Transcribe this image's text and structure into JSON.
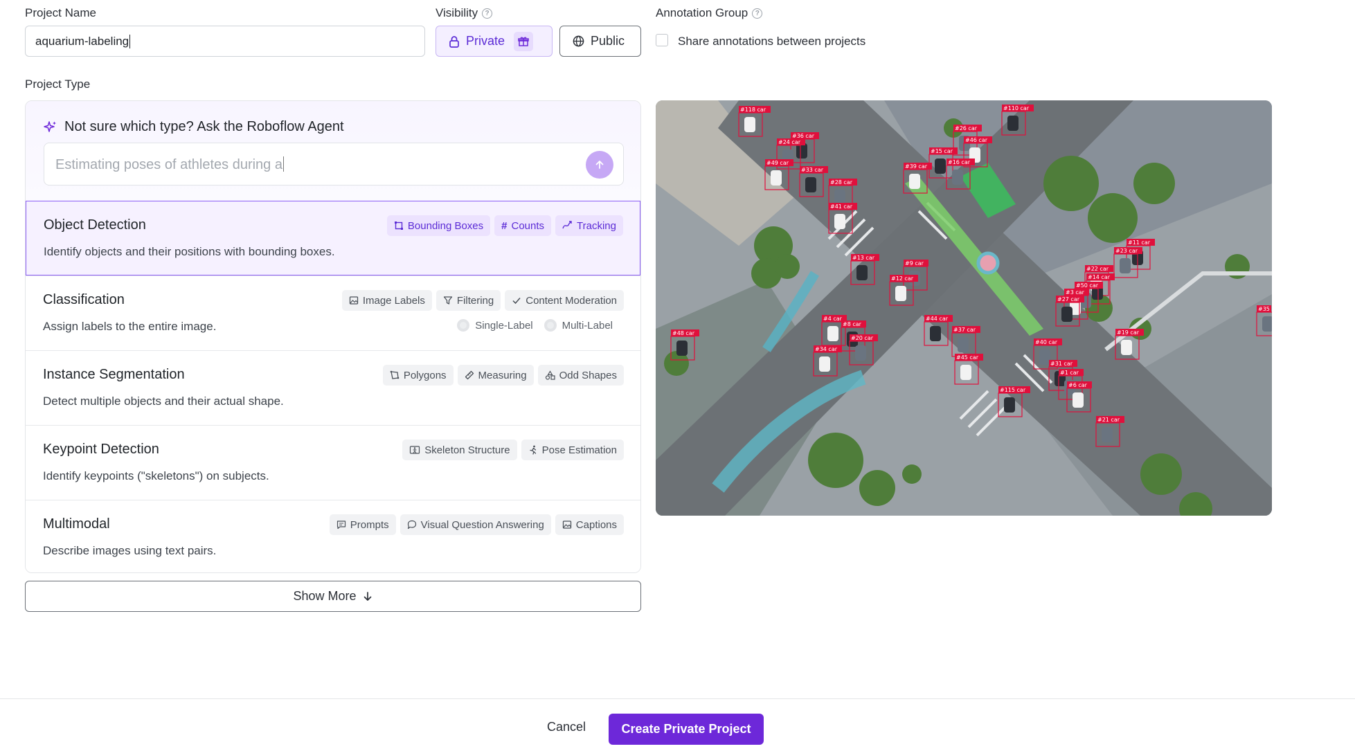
{
  "project_name": {
    "label": "Project Name",
    "value": "aquarium-labeling"
  },
  "visibility": {
    "label": "Visibility",
    "help_icon": "help-circle-icon",
    "private_label": "Private",
    "public_label": "Public",
    "selected": "Private"
  },
  "annotation_group": {
    "label": "Annotation Group",
    "help_icon": "help-circle-icon",
    "checkbox_label": "Share annotations between projects",
    "checked": false
  },
  "project_type": {
    "label": "Project Type",
    "agent": {
      "title": "Not sure which type? Ask the Roboflow Agent",
      "placeholder": "Estimating poses of athletes during a"
    },
    "types": [
      {
        "title": "Object Detection",
        "description": "Identify objects and their positions with bounding boxes.",
        "selected": true,
        "tags": [
          {
            "icon": "bounding-box-icon",
            "label": "Bounding Boxes"
          },
          {
            "icon": "hash-icon",
            "label": "Counts"
          },
          {
            "icon": "tracking-icon",
            "label": "Tracking"
          }
        ]
      },
      {
        "title": "Classification",
        "description": "Assign labels to the entire image.",
        "selected": false,
        "tags": [
          {
            "icon": "image-icon",
            "label": "Image Labels"
          },
          {
            "icon": "filter-icon",
            "label": "Filtering"
          },
          {
            "icon": "check-icon",
            "label": "Content Moderation"
          }
        ],
        "options": [
          "Single-Label",
          "Multi-Label"
        ]
      },
      {
        "title": "Instance Segmentation",
        "description": "Detect multiple objects and their actual shape.",
        "selected": false,
        "tags": [
          {
            "icon": "polygon-icon",
            "label": "Polygons"
          },
          {
            "icon": "ruler-icon",
            "label": "Measuring"
          },
          {
            "icon": "shapes-icon",
            "label": "Odd Shapes"
          }
        ]
      },
      {
        "title": "Keypoint Detection",
        "description": "Identify keypoints (\"skeletons\") on subjects.",
        "selected": false,
        "tags": [
          {
            "icon": "skeleton-icon",
            "label": "Skeleton Structure"
          },
          {
            "icon": "running-person-icon",
            "label": "Pose Estimation"
          }
        ]
      },
      {
        "title": "Multimodal",
        "description": "Describe images using text pairs.",
        "selected": false,
        "tags": [
          {
            "icon": "message-square-icon",
            "label": "Prompts"
          },
          {
            "icon": "chat-bubble-icon",
            "label": "Visual Question Answering"
          },
          {
            "icon": "image-icon",
            "label": "Captions"
          }
        ]
      }
    ],
    "show_more_label": "Show More"
  },
  "preview": {
    "labels": [
      "#118 car",
      "#36 car",
      "#24 car",
      "#49 car",
      "#33 car",
      "#28 car",
      "#41 car",
      "#110 car",
      "#26 car",
      "#46 car",
      "#15 car",
      "#16 car",
      "#39 car",
      "#13 car",
      "#9 car",
      "#12 car",
      "#11 car",
      "#23 car",
      "#22 car",
      "#14 car",
      "#50 car",
      "#3 car",
      "#27 car",
      "#35",
      "#4 car",
      "#8 car",
      "#20 car",
      "#34 car",
      "#44 car",
      "#37 car",
      "#45 car",
      "#48 car",
      "#40 car",
      "#19 car",
      "#31 car",
      "#1 car",
      "#6 car",
      "#115 car",
      "#21 car"
    ]
  },
  "footer": {
    "cancel_label": "Cancel",
    "create_label": "Create Private Project"
  },
  "colors": {
    "accent": "#6d28d9",
    "accent_light": "#f4efff",
    "selected_border": "#8b5cf6",
    "detection_box": "#e0103c"
  }
}
